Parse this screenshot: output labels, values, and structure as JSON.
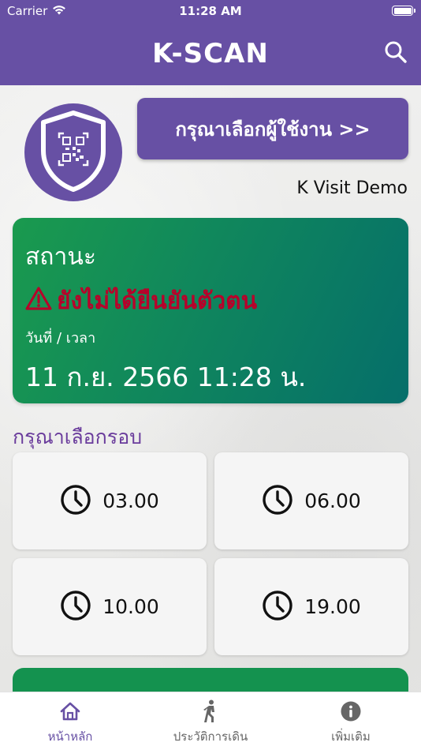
{
  "status_bar": {
    "carrier": "Carrier",
    "time": "11:28 AM"
  },
  "header": {
    "title": "K-SCAN",
    "search_icon": "search-icon"
  },
  "profile": {
    "badge_icon": "shield-qr-icon",
    "select_user_label": "กรุณาเลือกผู้ใช้งาน >>",
    "org_name": "K Visit Demo"
  },
  "status_card": {
    "label": "สถานะ",
    "warning_icon": "warning-icon",
    "warning_text": "ยังไม่ได้ยืนยันตัวตน",
    "datetime_label": "วันที่ / เวลา",
    "datetime_value": "11 ก.ย. 2566 11:28 น.",
    "colors": {
      "card_start": "#1a9a4e",
      "card_end": "#056e6a",
      "warning": "#b8002a"
    }
  },
  "rounds": {
    "title": "กรุณาเลือกรอบ",
    "items": [
      {
        "icon": "clock-icon",
        "time": "03.00"
      },
      {
        "icon": "clock-icon",
        "time": "06.00"
      },
      {
        "icon": "clock-icon",
        "time": "10.00"
      },
      {
        "icon": "clock-icon",
        "time": "19.00"
      }
    ]
  },
  "tab_bar": {
    "tabs": [
      {
        "icon": "home-icon",
        "label": "หน้าหลัก",
        "active": true
      },
      {
        "icon": "walking-person-icon",
        "label": "ประวัติการเดิน",
        "active": false
      },
      {
        "icon": "info-icon",
        "label": "เพิ่มเติม",
        "active": false
      }
    ]
  },
  "theme": {
    "primary": "#6750a4",
    "accent_text": "#6a3c9c"
  }
}
